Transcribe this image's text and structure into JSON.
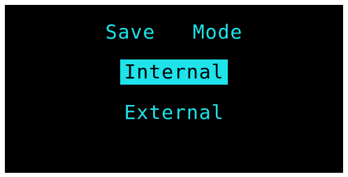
{
  "screen": {
    "title": "Save   Mode",
    "options": [
      {
        "label": "Internal",
        "selected": true
      },
      {
        "label": "External",
        "selected": false
      }
    ],
    "colors": {
      "background": "#000000",
      "text": "#1ee3ea",
      "highlight": "#1ee3ea"
    }
  }
}
